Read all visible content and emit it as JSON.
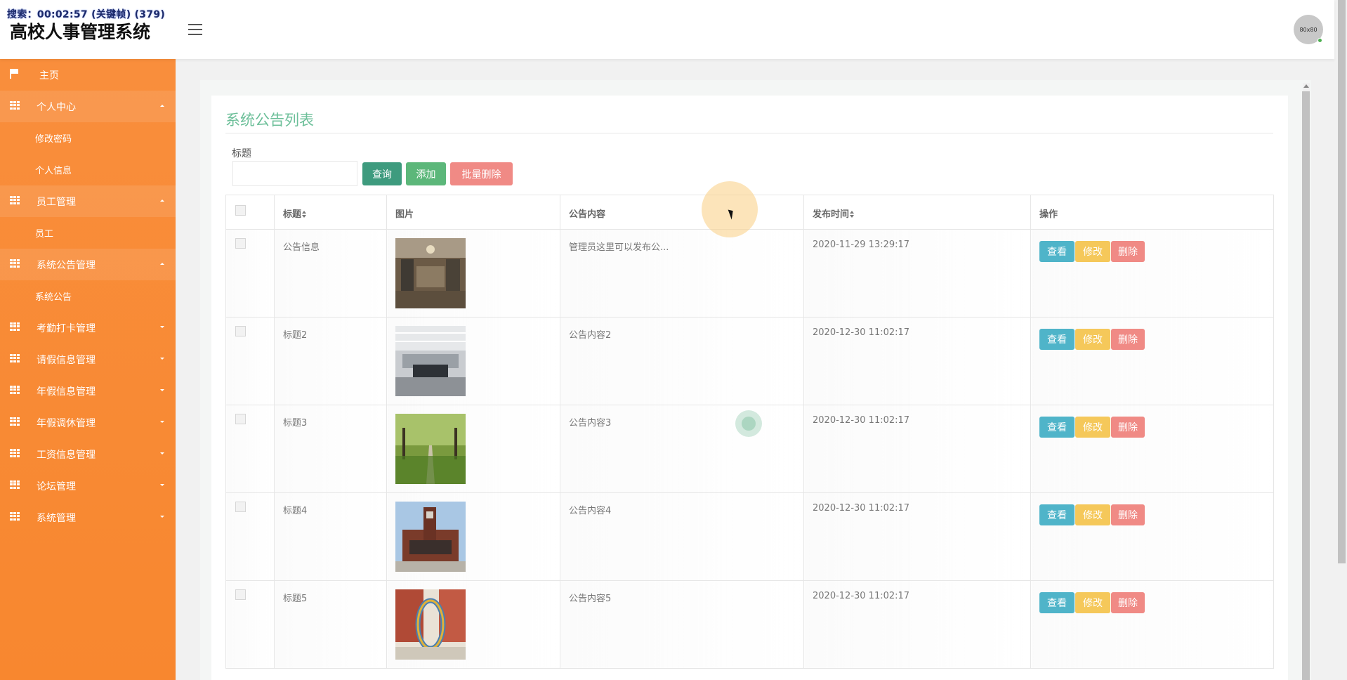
{
  "recording_overlay": "搜索：00:02:57 (关键帧) (379)",
  "header": {
    "app_title": "高校人事管理系统",
    "avatar_label": "80x80"
  },
  "sidebar": {
    "items": [
      {
        "label": "主页",
        "kind": "home"
      },
      {
        "label": "个人中心",
        "kind": "group",
        "open": true
      },
      {
        "label": "修改密码",
        "kind": "sub"
      },
      {
        "label": "个人信息",
        "kind": "sub"
      },
      {
        "label": "员工管理",
        "kind": "group",
        "open": true
      },
      {
        "label": "员工",
        "kind": "sub"
      },
      {
        "label": "系统公告管理",
        "kind": "group",
        "open": true
      },
      {
        "label": "系统公告",
        "kind": "sub"
      },
      {
        "label": "考勤打卡管理",
        "kind": "group",
        "open": false
      },
      {
        "label": "请假信息管理",
        "kind": "group",
        "open": false
      },
      {
        "label": "年假信息管理",
        "kind": "group",
        "open": false
      },
      {
        "label": "年假调休管理",
        "kind": "group",
        "open": false
      },
      {
        "label": "工资信息管理",
        "kind": "group",
        "open": false
      },
      {
        "label": "论坛管理",
        "kind": "group",
        "open": false
      },
      {
        "label": "系统管理",
        "kind": "group",
        "open": false
      }
    ]
  },
  "page": {
    "title": "系统公告列表",
    "search": {
      "label": "标题",
      "value": "",
      "placeholder": ""
    },
    "buttons": {
      "query": "查询",
      "add": "添加",
      "batch_delete": "批量删除"
    }
  },
  "table": {
    "headers": {
      "title": "标题",
      "image": "图片",
      "content": "公告内容",
      "time": "发布时间",
      "ops": "操作"
    },
    "row_actions": {
      "view": "查看",
      "edit": "修改",
      "delete": "删除"
    },
    "rows": [
      {
        "title": "公告信息",
        "content": "管理员这里可以发布公...",
        "time": "2020-11-29 13:29:17",
        "image": "library-interior"
      },
      {
        "title": "标题2",
        "content": "公告内容2",
        "time": "2020-12-30 11:02:17",
        "image": "meeting-room"
      },
      {
        "title": "标题3",
        "content": "公告内容3",
        "time": "2020-12-30 11:02:17",
        "image": "tree-lined-path"
      },
      {
        "title": "标题4",
        "content": "公告内容4",
        "time": "2020-12-30 11:02:17",
        "image": "campus-tower"
      },
      {
        "title": "标题5",
        "content": "公告内容5",
        "time": "2020-12-30 11:02:17",
        "image": "ring-sculpture"
      }
    ]
  },
  "colors": {
    "sidebar": "#f98e3c",
    "title_green": "#6cbf99",
    "query_btn": "#3e9b7e",
    "add_btn": "#5cb77a",
    "delete_btn": "#f08a85",
    "view_btn": "#4fb4c9",
    "edit_btn": "#f5c85a"
  }
}
